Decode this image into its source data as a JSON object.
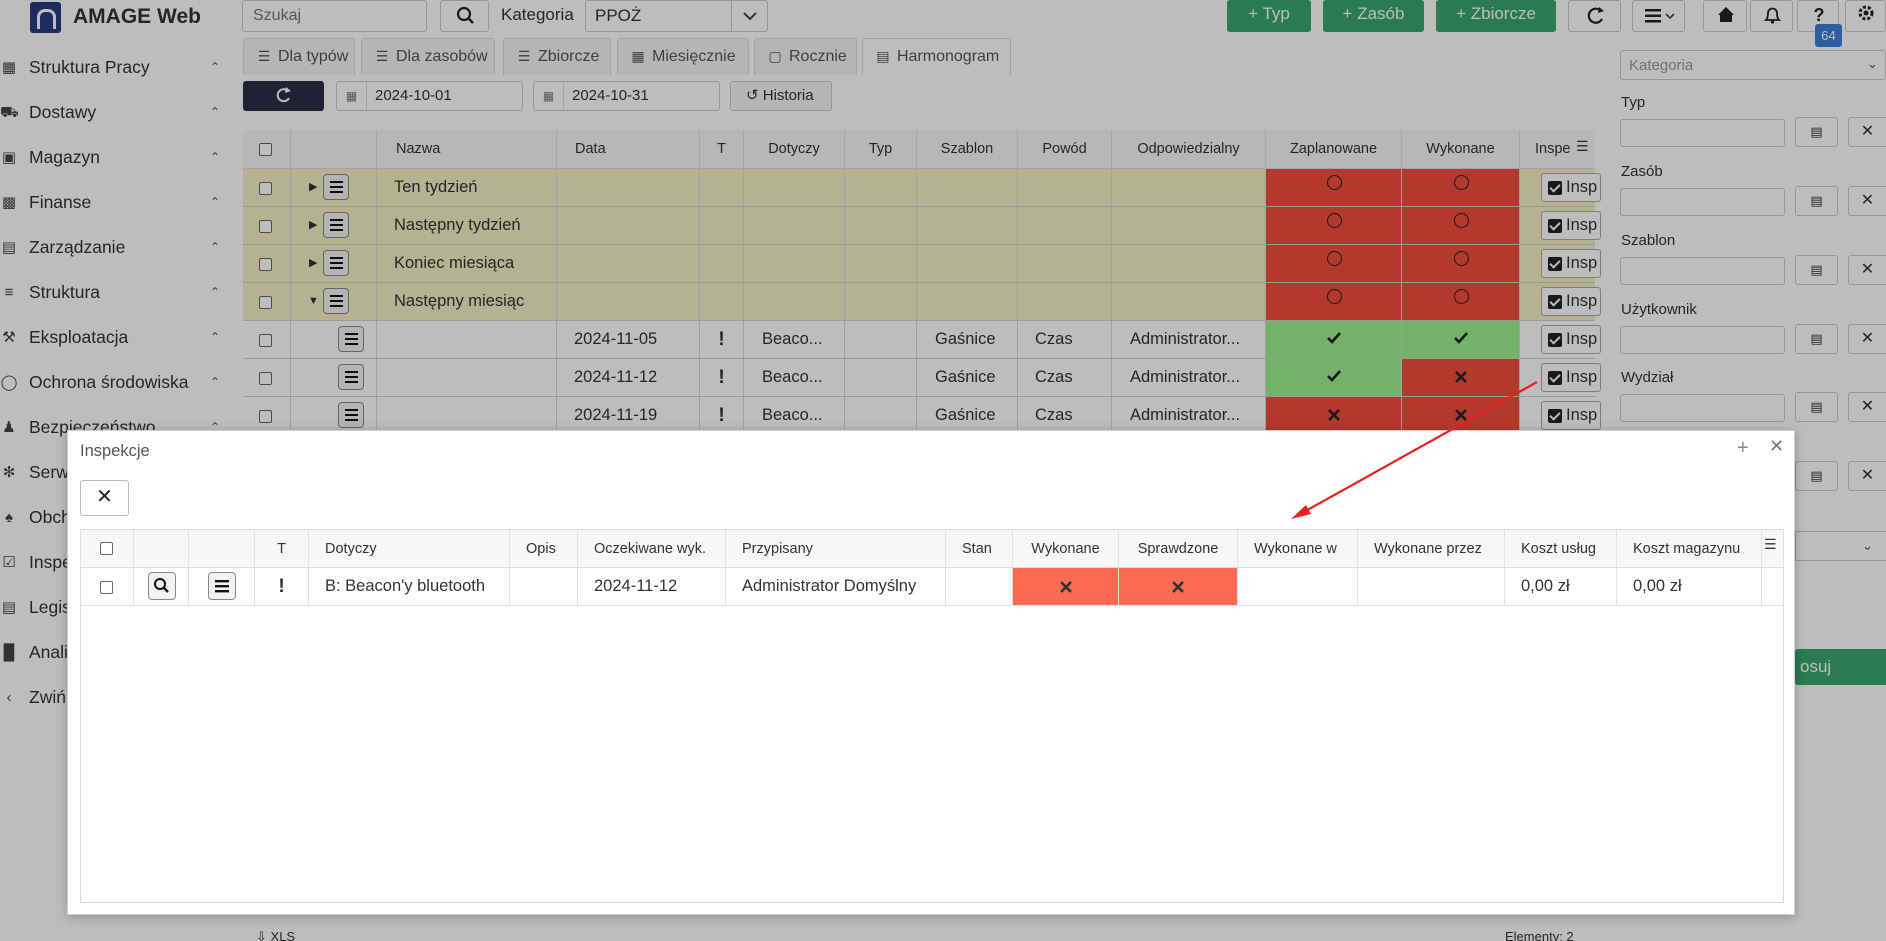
{
  "app": {
    "title": "AMAGE Web"
  },
  "sidebar": {
    "items": [
      {
        "label": "Struktura Pracy",
        "icon": "sitemap-icon"
      },
      {
        "label": "Dostawy",
        "icon": "truck-icon"
      },
      {
        "label": "Magazyn",
        "icon": "warehouse-icon"
      },
      {
        "label": "Finanse",
        "icon": "money-icon"
      },
      {
        "label": "Zarządzanie",
        "icon": "briefcase-icon"
      },
      {
        "label": "Struktura",
        "icon": "layers-icon"
      },
      {
        "label": "Eksploatacja",
        "icon": "tools-icon"
      },
      {
        "label": "Ochrona środowiska",
        "icon": "globe-icon"
      },
      {
        "label": "Bezpieczeństwo",
        "icon": "user-shield-icon"
      },
      {
        "label": "Serw",
        "icon": "bug-icon"
      },
      {
        "label": "Obch",
        "icon": "walk-icon"
      },
      {
        "label": "Inspe",
        "icon": "check-square-icon"
      },
      {
        "label": "Legis",
        "icon": "book-icon"
      },
      {
        "label": "Anali",
        "icon": "bar-chart-icon"
      },
      {
        "label": "Zwiń",
        "icon": "chevron-left-icon"
      }
    ]
  },
  "toolbar": {
    "search_placeholder": "Szukaj",
    "category_label": "Kategoria",
    "category_value": "PPOŻ",
    "add_type": "+ Typ",
    "add_resource": "+ Zasób",
    "add_collective": "+ Zbiorcze",
    "notification_count": "64"
  },
  "tabs": [
    {
      "label": "Dla typów"
    },
    {
      "label": "Dla zasobów"
    },
    {
      "label": "Zbiorcze"
    },
    {
      "label": "Miesięcznie"
    },
    {
      "label": "Rocznie"
    },
    {
      "label": "Harmonogram",
      "active": true
    }
  ],
  "filters": {
    "date_from": "2024-10-01",
    "date_to": "2024-10-31",
    "history_label": "Historia"
  },
  "grid": {
    "columns": [
      "Nazwa",
      "Data",
      "T",
      "Dotyczy",
      "Typ",
      "Szablon",
      "Powód",
      "Odpowiedzialny",
      "Zaplanowane",
      "Wykonane",
      "Inspe"
    ],
    "groups": [
      {
        "name": "Ten tydzień"
      },
      {
        "name": "Następny tydzień"
      },
      {
        "name": "Koniec miesiąca"
      },
      {
        "name": "Następny miesiąc"
      }
    ],
    "rows": [
      {
        "date": "2024-11-05",
        "t": "!",
        "concerns": "Beaco...",
        "template": "Gaśnice",
        "reason": "Czas",
        "responsible": "Administrator...",
        "planned": "check",
        "done": "check"
      },
      {
        "date": "2024-11-12",
        "t": "!",
        "concerns": "Beaco...",
        "template": "Gaśnice",
        "reason": "Czas",
        "responsible": "Administrator...",
        "planned": "check",
        "done": "cross"
      },
      {
        "date": "2024-11-19",
        "t": "!",
        "concerns": "Beaco...",
        "template": "Gaśnice",
        "reason": "Czas",
        "responsible": "Administrator...",
        "planned": "cross",
        "done": "cross"
      }
    ],
    "chip_label": "Insp"
  },
  "right_panel": {
    "category_placeholder": "Kategoria",
    "fields": [
      {
        "label": "Typ"
      },
      {
        "label": "Zasób"
      },
      {
        "label": "Szablon"
      },
      {
        "label": "Użytkownik"
      },
      {
        "label": "Wydział"
      }
    ],
    "apply_label": "osuj"
  },
  "modal": {
    "title": "Inspekcje",
    "columns": [
      "T",
      "Dotyczy",
      "Opis",
      "Oczekiwane wyk.",
      "Przypisany",
      "Stan",
      "Wykonane",
      "Sprawdzone",
      "Wykonane w",
      "Wykonane przez",
      "Koszt usług",
      "Koszt magazynu"
    ],
    "row": {
      "t": "!",
      "concerns": "B: Beacon'y bluetooth",
      "description": "",
      "expected": "2024-11-12",
      "assigned": "Administrator Domyślny",
      "state": "",
      "done_in": "",
      "done_by": "",
      "service_cost": "0,00 zł",
      "storage_cost": "0,00 zł"
    }
  },
  "footer": {
    "export_label": "XLS",
    "count_label": "Elementy: 2"
  },
  "colors": {
    "red": "#f04d3a",
    "green": "#9ef08e",
    "orange": "#ff6b52",
    "accent_green": "#3aa76d",
    "group_row": "#f2f2c6"
  }
}
